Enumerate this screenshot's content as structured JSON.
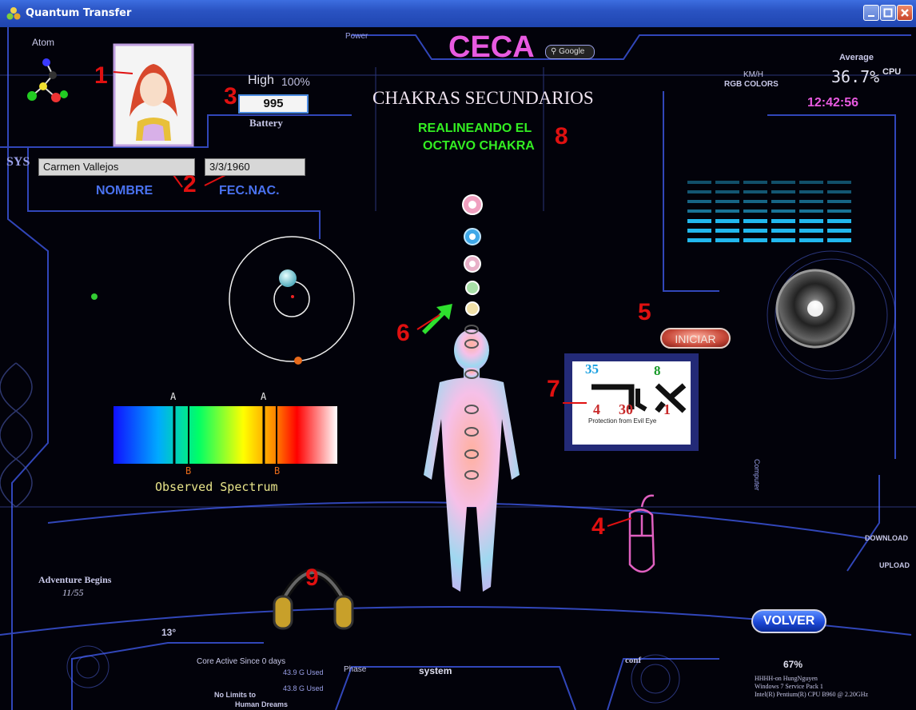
{
  "window": {
    "title": "Quantum Transfer"
  },
  "header": {
    "app_name": "CECA",
    "search_label": "Google",
    "screen_title": "CHAKRAS SECUNDARIOS"
  },
  "status": {
    "message_line1": "REALINEANDO EL",
    "message_line2": "OCTAVO CHAKRA"
  },
  "hud": {
    "atom_label": "Atom",
    "power_label": "Power",
    "battery_level": "High",
    "battery_percent": "100%",
    "battery_label": "Battery",
    "kmh_label": "KM/H",
    "rgb_label": "RGB COLORS",
    "average_label": "Average",
    "cpu_label": "CPU",
    "cpu_value": "36.7%",
    "time": "12:42:56",
    "sys_label": "SYS",
    "adventure_title": "Adventure Begins",
    "adventure_value": "11/55",
    "temperature": "13°",
    "core_active": "Core Active Since 0 days",
    "used_1": "43.9 G Used",
    "used_2": "43.8 G Used",
    "phase_label": "Phase",
    "system_label": "system",
    "conf_label": "conf",
    "percent_67": "67%",
    "download_label": "DOWNLOAD",
    "upload_label": "UPLOAD",
    "computer_label": "Computer",
    "sysinfo_line1": "HHHH-on HungNguyen",
    "sysinfo_line2": "Windows 7 Service Pack 1",
    "sysinfo_line3": "Intel(R) Pentium(R) CPU B960 @ 2.20GHz",
    "no_limits": "No Limits to",
    "human_dreams": "Human Dreams"
  },
  "form": {
    "name_value": "Carmen Vallejos",
    "name_label": "NOMBRE",
    "dob_value": "3/3/1960",
    "dob_label": "FEC.NAC."
  },
  "rate": {
    "value": "995"
  },
  "spectrum": {
    "label": "Observed Spectrum",
    "top_marker": "A",
    "bottom_marker": "B"
  },
  "rune": {
    "top_left": "35",
    "top_right": "8",
    "bottom_left": "4",
    "bottom_mid": "30",
    "bottom_right": "1",
    "caption": "Protection from Evil Eye"
  },
  "buttons": {
    "iniciar": "INICIAR",
    "volver": "VOLVER"
  },
  "callouts": [
    "1",
    "2",
    "3",
    "4",
    "5",
    "6",
    "7",
    "8",
    "9"
  ],
  "colors": {
    "title_pink": "#e85ae0",
    "status_green": "#33ee22",
    "callout_red": "#e01010",
    "hud_blue": "#3a52d8"
  }
}
